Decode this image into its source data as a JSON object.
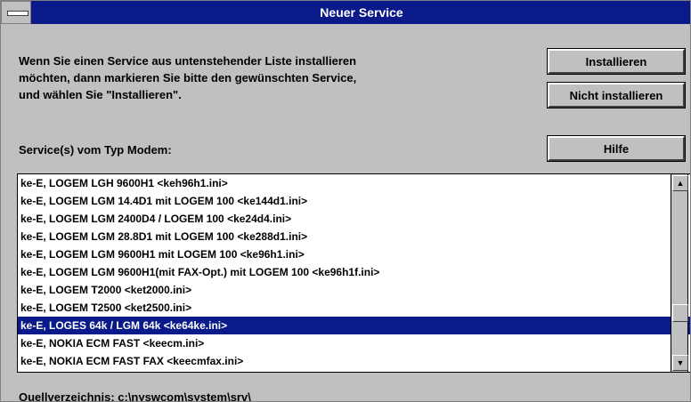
{
  "window": {
    "title": "Neuer Service"
  },
  "description": [
    "Wenn Sie einen Service aus untenstehender Liste installieren",
    "möchten, dann markieren Sie bitte den gewünschten Service,",
    "und wählen Sie \"Installieren\"."
  ],
  "buttons": {
    "install": "Installieren",
    "dont_install": "Nicht installieren",
    "help": "Hilfe"
  },
  "service_label": "Service(s) vom Typ Modem:",
  "services": [
    "ke-E, LOGEM LGH 9600H1  <keh96h1.ini>",
    "ke-E, LOGEM LGM 14.4D1 mit LOGEM 100  <ke144d1.ini>",
    "ke-E, LOGEM LGM 2400D4 / LOGEM 100  <ke24d4.ini>",
    "ke-E, LOGEM LGM 28.8D1 mit LOGEM 100  <ke288d1.ini>",
    "ke-E, LOGEM LGM 9600H1 mit LOGEM 100  <ke96h1.ini>",
    "ke-E, LOGEM LGM 9600H1(mit FAX-Opt.) mit LOGEM 100  <ke96h1f.ini>",
    "ke-E, LOGEM T2000  <ket2000.ini>",
    "ke-E, LOGEM T2500  <ket2500.ini>",
    "ke-E, LOGES 64k / LGM 64k  <ke64ke.ini>",
    "ke-E, NOKIA ECM FAST  <keecm.ini>",
    "ke-E, NOKIA ECM FAST FAX  <keecmfax.ini>"
  ],
  "selected_index": 8,
  "source_dir": "Quellverzeichnis: c:\\nyswcom\\system\\srv\\",
  "colors": {
    "titlebar": "#0a1a8a",
    "face": "#c0c0c0",
    "selection": "#0a1a8a"
  }
}
